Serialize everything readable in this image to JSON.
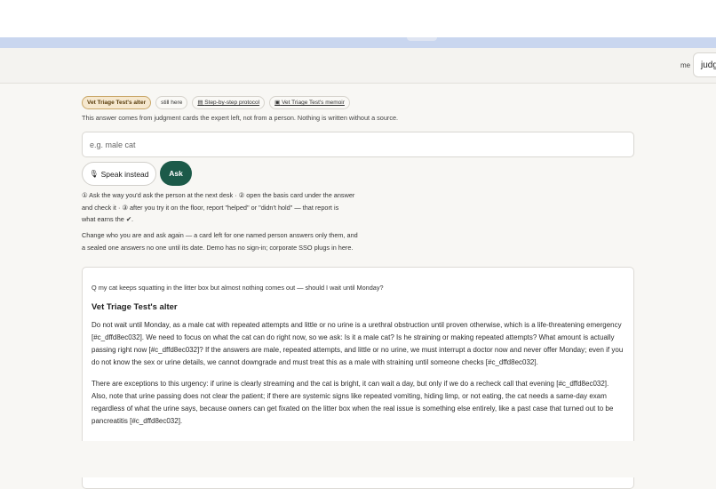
{
  "header": {
    "user_label": "me",
    "judge_value": "judge"
  },
  "tabs": {
    "alter_label": "Vet Triage Test's alter",
    "still_here_label": "still here",
    "protocol_label": "Step-by-step protocol",
    "memoir_label": "Vet Triage Test's memoir",
    "protocol_icon": "▤",
    "memoir_icon": "▣"
  },
  "source_note": "This answer comes from judgment cards the expert left, not from a person. Nothing is written without a source.",
  "ask": {
    "placeholder": "e.g. male cat",
    "speak_label": "Speak instead",
    "speak_icon": "🎙",
    "ask_label": "Ask"
  },
  "help": {
    "line1": "① Ask the way you'd ask the person at the next desk · ② open the basis card under the answer",
    "line2": "and check it · ③ after you try it on the floor, report \"helped\" or \"didn't hold\" — that report is",
    "line3": "what earns the ✔.",
    "line4": "Change who you are and ask again — a card left for one named person answers only them, and",
    "line5": "a sealed one answers no one until its date. Demo has no sign-in; corporate SSO plugs in here."
  },
  "answer": {
    "question": "Q my cat keeps squatting in the litter box but almost nothing comes out — should I wait until Monday?",
    "title": "Vet Triage Test's alter",
    "para1": "Do not wait until Monday, as a male cat with repeated attempts and little or no urine is a urethral obstruction until proven otherwise, which is a life-threatening emergency [#c_dffd8ec032]. We need to focus on what the cat can do right now, so we ask: Is it a male cat? Is he straining or making repeated attempts? What amount is actually passing right now [#c_dffd8ec032]? If the answers are male, repeated attempts, and little or no urine, we must interrupt a doctor now and never offer Monday; even if you do not know the sex or urine details, we cannot downgrade and must treat this as a male with straining until someone checks [#c_dffd8ec032].",
    "para2": "There are exceptions to this urgency: if urine is clearly streaming and the cat is bright, it can wait a day, but only if we do a recheck call that evening [#c_dffd8ec032]. Also, note that urine passing does not clear the patient; if there are systemic signs like repeated vomiting, hiding limp, or not eating, the cat needs a same-day exam regardless of what the urine says, because owners can get fixated on the litter box when the real issue is something else entirely, like a past case that turned out to be pancreatitis [#c_dffd8ec032]."
  }
}
